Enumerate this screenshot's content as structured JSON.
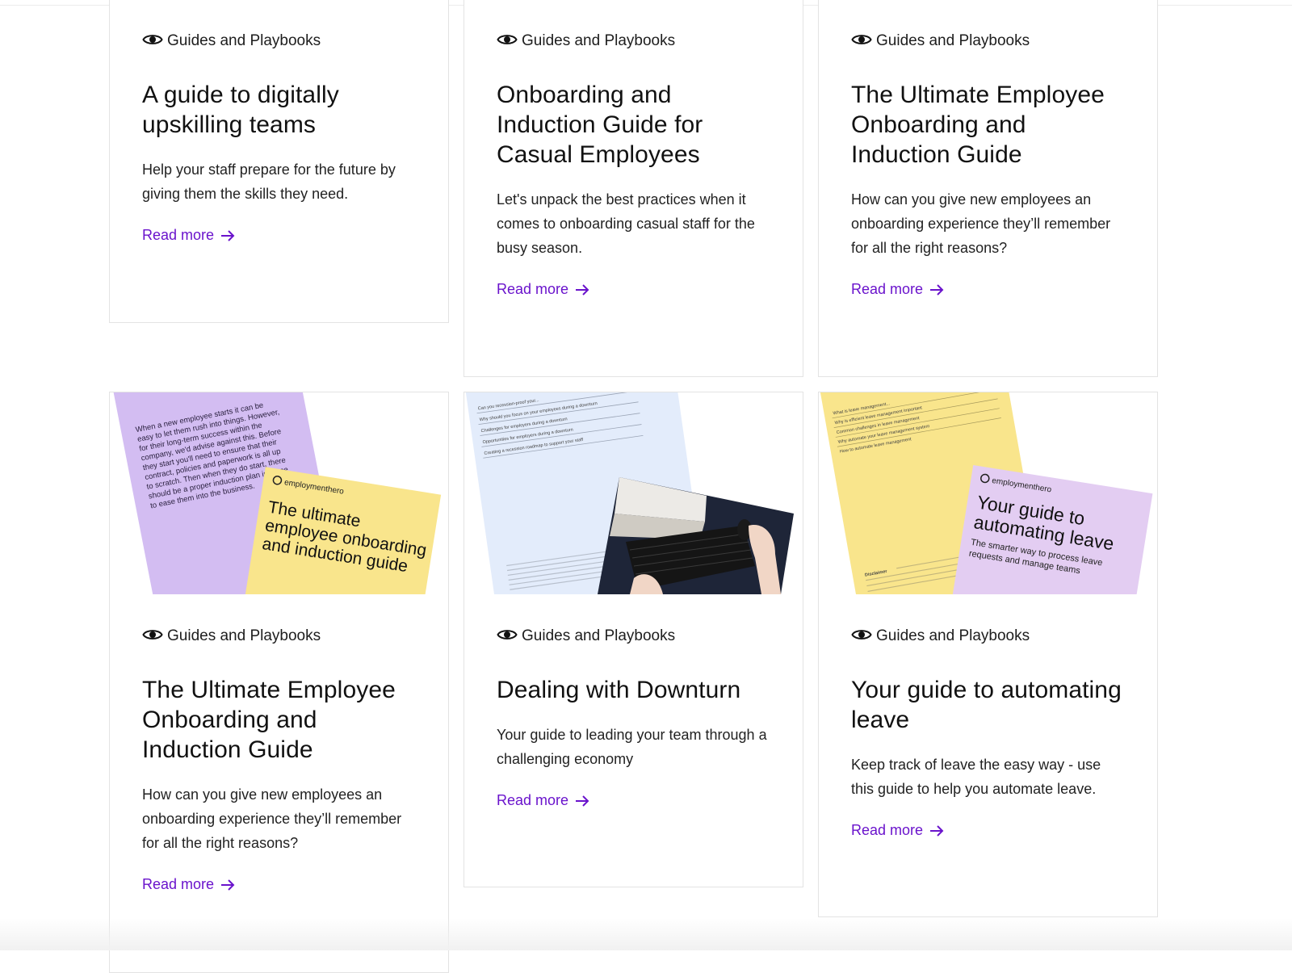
{
  "cards": [
    {
      "category": "Guides and Playbooks",
      "title": "A guide to digitally upskilling teams",
      "description": "Help your staff prepare for the future by giving them the skills they need.",
      "link": "Read more"
    },
    {
      "category": "Guides and Playbooks",
      "title": "Onboarding and Induction Guide for Casual Employees",
      "description": "Let's unpack the best practices when it comes to onboarding casual staff for the busy season.",
      "link": "Read more"
    },
    {
      "category": "Guides and Playbooks",
      "title": "The Ultimate Employee Onboarding and Induction Guide",
      "description": "How can you give new employees an onboarding experience they’ll remember for all the right reasons?",
      "link": "Read more"
    },
    {
      "category": "Guides and Playbooks",
      "title": "The Ultimate Employee Onboarding and Induction Guide",
      "description": "How can you give new employees an onboarding experience they’ll remember for all the right reasons?",
      "link": "Read more",
      "thumbnail": {
        "doc_text": "When a new employee starts it can be easy to let them rush into things. However, for their long-term success within the company, we'd advise against this. Before they start you'll need to ensure that their contract, policies and paperwork is all up to scratch. Then when they do start, there should be a proper induction plan in place to ease them into the business.",
        "brand": "employmenthero",
        "cover_title": "The ultimate employee onboarding and induction guide"
      }
    },
    {
      "category": "Guides and Playbooks",
      "title": "Dealing with Downturn",
      "description": "Your guide to leading your team through a challenging economy",
      "link": "Read more",
      "thumbnail": {
        "toc": [
          "Can you recession-proof your...",
          "Why should you focus on your employees during a downturn",
          "Challenges for employers during a downturn",
          "Opportunities for employers during a downturn",
          "Creating a recession roadmap to support your staff"
        ]
      }
    },
    {
      "category": "Guides and Playbooks",
      "title": "Your guide to automating leave",
      "description": "Keep track of leave the easy way - use this guide to help you automate leave.",
      "link": "Read more",
      "thumbnail": {
        "toc": [
          "What is leave management...",
          "Why is efficient leave management important",
          "Common challenges in leave management",
          "Why automate your leave management system",
          "How to automate leave management"
        ],
        "disclaimer": "Disclaimer",
        "brand": "employmenthero",
        "cover_title": "Your guide to automating leave",
        "cover_subtitle": "The smarter way to process leave requests and manage teams"
      }
    }
  ],
  "colors": {
    "link": "#6a13cc",
    "purple_doc": "#d3bdf2",
    "yellow_doc": "#f9e58c",
    "blue_doc": "#e3ecfb",
    "lilac_cover": "#e3cdf2"
  },
  "icons": {
    "category": "eye-icon",
    "link": "arrow-right-icon"
  }
}
